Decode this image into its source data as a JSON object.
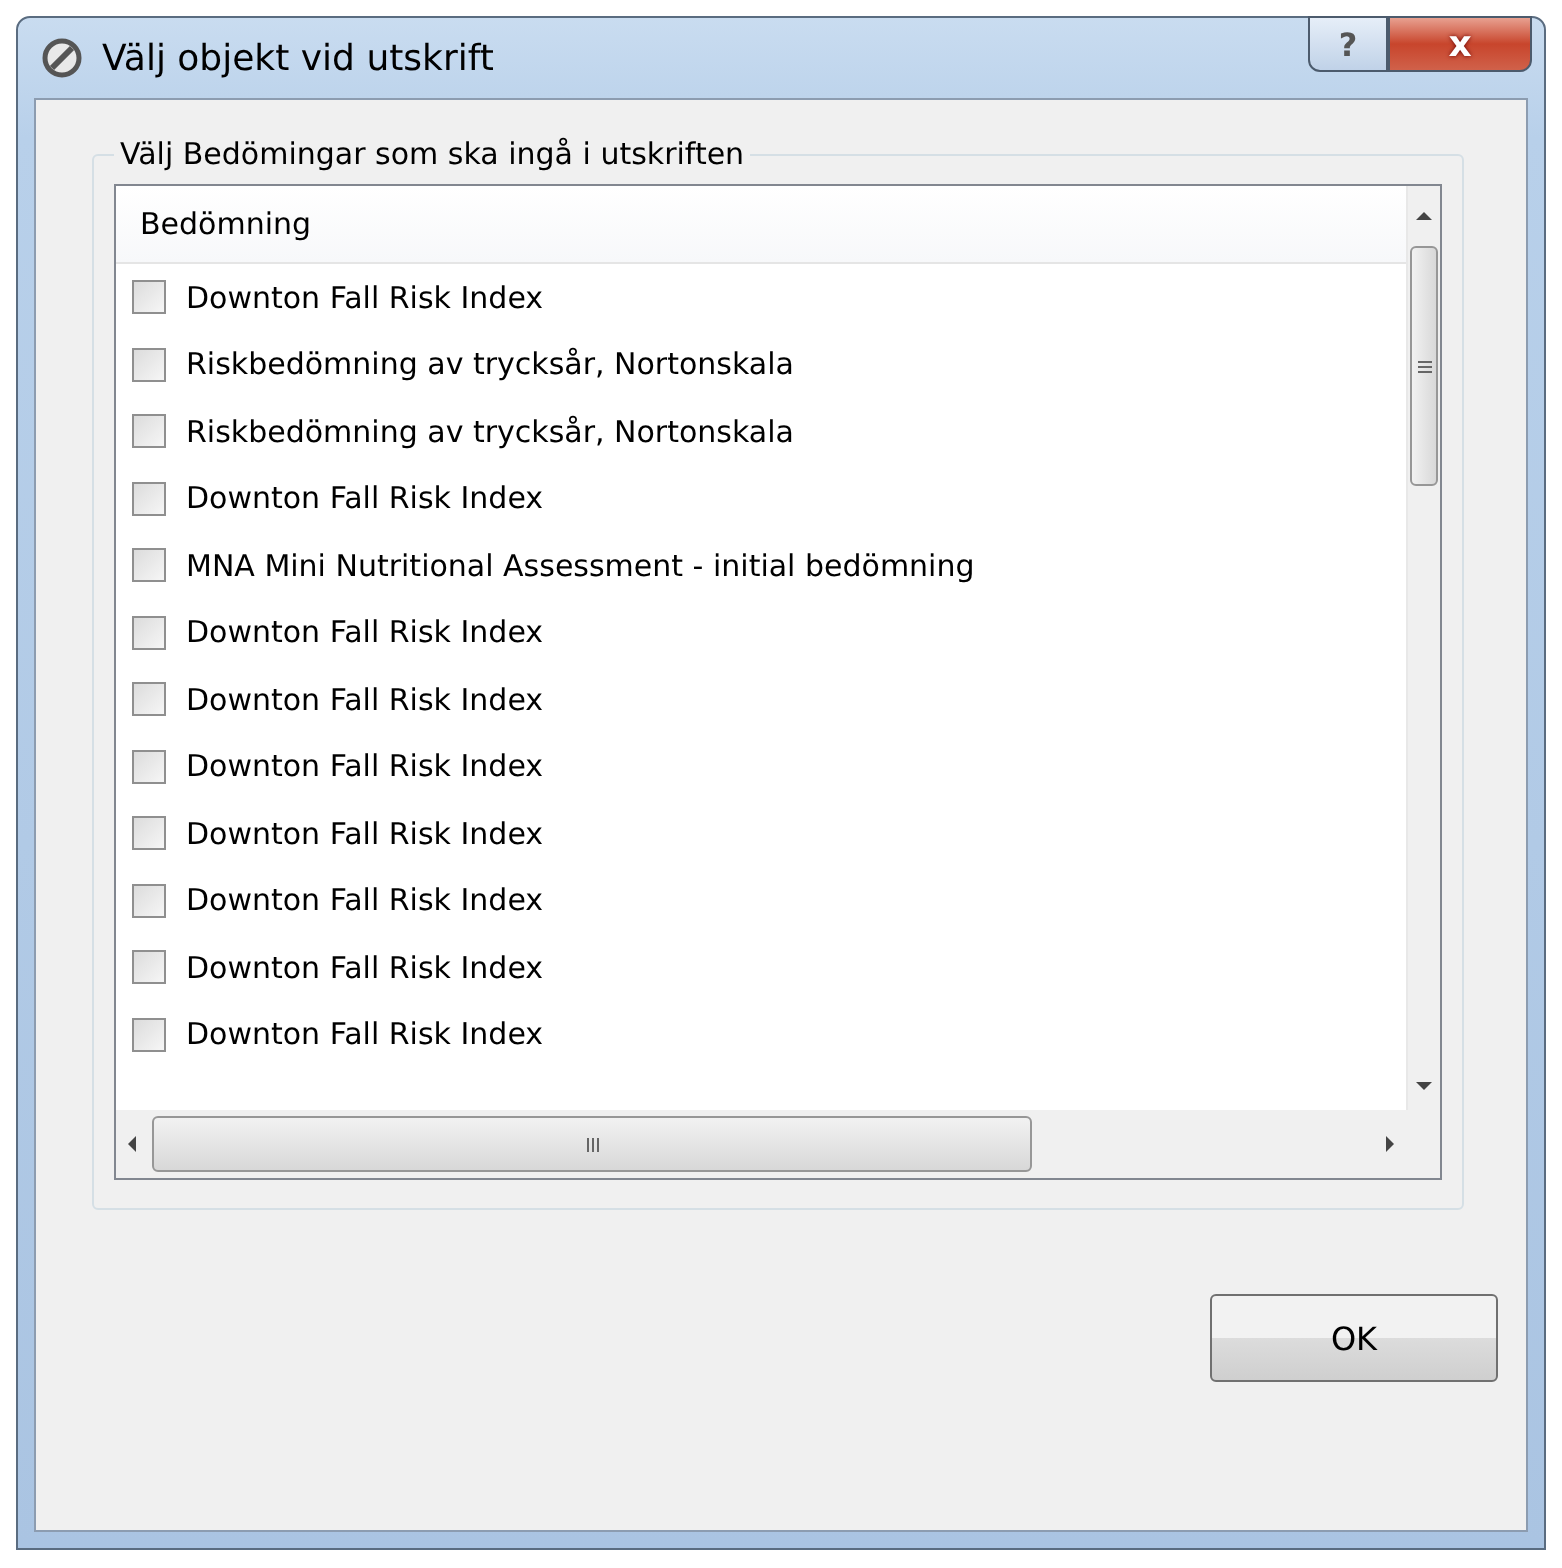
{
  "window": {
    "title": "Välj objekt vid utskrift",
    "help_button": "?",
    "close_button": "x"
  },
  "group": {
    "legend": "Välj Bedömingar som ska ingå i utskriften"
  },
  "list": {
    "column": "Bedömning",
    "items": [
      {
        "label": "Downton Fall Risk Index",
        "checked": false
      },
      {
        "label": "Riskbedömning av trycksår, Nortonskala",
        "checked": false
      },
      {
        "label": "Riskbedömning av trycksår, Nortonskala",
        "checked": false
      },
      {
        "label": "Downton Fall Risk Index",
        "checked": false
      },
      {
        "label": "MNA Mini Nutritional Assessment - initial bedömning",
        "checked": false
      },
      {
        "label": "Downton Fall Risk Index",
        "checked": false
      },
      {
        "label": "Downton Fall Risk Index",
        "checked": false
      },
      {
        "label": "Downton Fall Risk Index",
        "checked": false
      },
      {
        "label": "Downton Fall Risk Index",
        "checked": false
      },
      {
        "label": "Downton Fall Risk Index",
        "checked": false
      },
      {
        "label": "Downton Fall Risk Index",
        "checked": false
      },
      {
        "label": "Downton Fall Risk Index",
        "checked": false
      }
    ]
  },
  "buttons": {
    "ok": "OK"
  }
}
